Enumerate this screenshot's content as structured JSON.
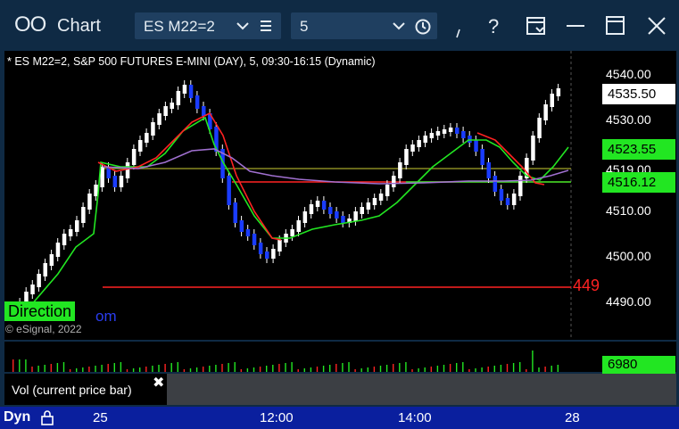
{
  "window": {
    "title": "Chart",
    "app_icon": "chart-window-icon",
    "symbol": "ES M22=2",
    "interval": "5"
  },
  "chart_header": "* ES M22=2, S&P 500 FUTURES E-MINI (DAY), 5, 09:30-16:15 (Dynamic)",
  "price_axis": {
    "ticks": [
      "4540.00",
      "4530.00",
      "4510.00",
      "4500.00",
      "4490.00"
    ],
    "overlap_tick": "4519.00",
    "last_price": "4535.50",
    "labels": [
      "4523.55",
      "4516.12"
    ],
    "label_colors": {
      "last": "#ffffff",
      "green": "#22e622"
    }
  },
  "overlay": {
    "direction_label": "Direction",
    "partial_text": "om",
    "copyright": "© eSignal, 2022",
    "red_price_label": "449"
  },
  "volume": {
    "value": "6980",
    "study_label": "Vol (current price bar)"
  },
  "time_axis": {
    "mode": "Dyn",
    "ticks": [
      "25",
      "12:00",
      "14:00",
      "28"
    ]
  },
  "chart_data": {
    "type": "candlestick",
    "symbol": "ES M22=2",
    "ylim": [
      4488,
      4543
    ],
    "horizontal_lines": [
      4519,
      4516.12,
      4493
    ],
    "series": [
      {
        "name": "",
        "color": "#22e622"
      },
      {
        "name": "",
        "color": "#ff2222"
      },
      {
        "name": "",
        "color": "#a070d0"
      }
    ]
  }
}
